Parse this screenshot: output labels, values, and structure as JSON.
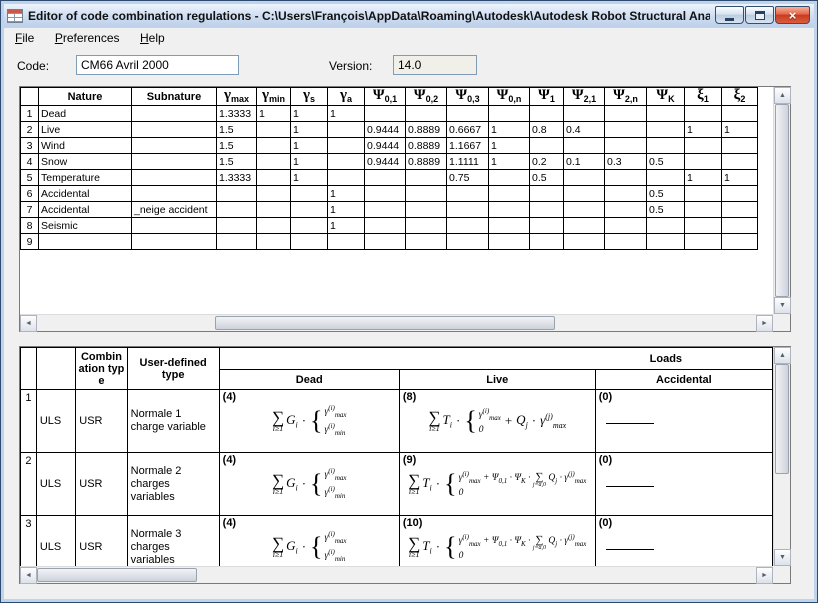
{
  "window": {
    "title": "Editor of code combination regulations - C:\\Users\\François\\AppData\\Roaming\\Autodesk\\Autodesk Robot Structural Analysis ..."
  },
  "colors": {
    "titlebar": "#cdddf2",
    "close_button": "#d9512f",
    "grid_line": "#000000",
    "client_bg": "#f0f0f0"
  },
  "menu": {
    "items": [
      {
        "label": "File"
      },
      {
        "label": "Preferences"
      },
      {
        "label": "Help"
      }
    ]
  },
  "form": {
    "code_label": "Code:",
    "code_value": "CM66 Avril 2000",
    "version_label": "Version:",
    "version_value": "14.0"
  },
  "factors_table": {
    "headers": [
      "",
      "Nature",
      "Subnature",
      "<span class='gk'>γ</span><sub>max</sub>",
      "<span class='gk'>γ</span><sub>min</sub>",
      "<span class='gk'>γ</span><sub>s</sub>",
      "<span class='gk'>γ</span><sub>a</sub>",
      "<span class='gk'>Ψ</span><sub>0,1</sub>",
      "<span class='gk'>Ψ</span><sub>0,2</sub>",
      "<span class='gk'>Ψ</span><sub>0,3</sub>",
      "<span class='gk'>Ψ</span><sub>0,n</sub>",
      "<span class='gk'>Ψ</span><sub>1</sub>",
      "<span class='gk'>Ψ</span><sub>2,1</sub>",
      "<span class='gk'>Ψ</span><sub>2,n</sub>",
      "<span class='gk'>Ψ</span><sub>K</sub>",
      "<span class='gk'>ξ</span><sub>1</sub>",
      "<span class='gk'>ξ</span><sub>2</sub>"
    ],
    "rows": [
      [
        "1",
        "Dead",
        "",
        "1.3333",
        "1",
        "1",
        "1",
        "",
        "",
        "",
        "",
        "",
        "",
        "",
        "",
        "",
        ""
      ],
      [
        "2",
        "Live",
        "",
        "1.5",
        "",
        "1",
        "",
        "0.9444",
        "0.8889",
        "0.6667",
        "1",
        "0.8",
        "0.4",
        "",
        "",
        "1",
        "1"
      ],
      [
        "3",
        "Wind",
        "",
        "1.5",
        "",
        "1",
        "",
        "0.9444",
        "0.8889",
        "1.1667",
        "1",
        "",
        "",
        "",
        "",
        "",
        ""
      ],
      [
        "4",
        "Snow",
        "",
        "1.5",
        "",
        "1",
        "",
        "0.9444",
        "0.8889",
        "1.1111",
        "1",
        "0.2",
        "0.1",
        "0.3",
        "0.5",
        "",
        ""
      ],
      [
        "5",
        "Temperature",
        "",
        "1.3333",
        "",
        "1",
        "",
        "",
        "",
        "0.75",
        "",
        "0.5",
        "",
        "",
        "",
        "1",
        "1"
      ],
      [
        "6",
        "Accidental",
        "",
        "",
        "",
        "",
        "1",
        "",
        "",
        "",
        "",
        "",
        "",
        "",
        "0.5",
        "",
        ""
      ],
      [
        "7",
        "Accidental",
        "_neige accident",
        "",
        "",
        "",
        "1",
        "",
        "",
        "",
        "",
        "",
        "",
        "",
        "0.5",
        "",
        ""
      ],
      [
        "8",
        "Seismic",
        "",
        "",
        "",
        "",
        "1",
        "",
        "",
        "",
        "",
        "",
        "",
        "",
        "",
        "",
        ""
      ],
      [
        "9",
        "",
        "",
        "",
        "",
        "",
        "",
        "",
        "",
        "",
        "",
        "",
        "",
        "",
        "",
        "",
        ""
      ]
    ]
  },
  "combinations_table": {
    "headers": {
      "combination_type": "Combination type",
      "user_defined_type": "User-defined type",
      "loads_group": "Loads",
      "load_columns": [
        "Dead",
        "Live",
        "Accidental"
      ]
    },
    "rows": [
      {
        "num": "1",
        "limit_state": "ULS",
        "combination_type": "USR",
        "name": "Normale 1 charge variable",
        "loads": [
          {
            "tag": "(4)",
            "formula_html": "<span class='bo'><span class='bos'>∑</span><span class='bol'>i≥1</span></span><span class='it'>G<sub>i</sub></span><span class='dot'>·</span><span class='br'>{</span><span class='st'><span>γ<sup>(i)</sup><sub>max</sub></span><span>γ<sup>(i)</sup><sub>min</sub></span></span>"
          },
          {
            "tag": "(8)",
            "formula_html": "<span class='bo'><span class='bos'>∑</span><span class='bol'>i≥1</span></span><span class='it'>T<sub>i</sub></span><span class='dot'>·</span><span class='br'>{</span><span class='st'><span>γ<sup>(i)</sup><sub>max</sub></span><span>0</span></span><span class='dot'>+</span><span class='it'>Q<sub>j</sub></span><span class='dot'>·</span><span class='it'>γ<sup>(j)</sup><sub>max</sub></span>"
          },
          {
            "tag": "(0)",
            "formula_html": "<span class='dashline'></span>"
          }
        ]
      },
      {
        "num": "2",
        "limit_state": "ULS",
        "combination_type": "USR",
        "name": "Normale 2 charges variables",
        "loads": [
          {
            "tag": "(4)",
            "formula_html": "<span class='bo'><span class='bos'>∑</span><span class='bol'>i≥1</span></span><span class='it'>G<sub>i</sub></span><span class='dot'>·</span><span class='br'>{</span><span class='st'><span>γ<sup>(i)</sup><sub>max</sub></span><span>γ<sup>(i)</sup><sub>min</sub></span></span>"
          },
          {
            "tag": "(9)",
            "formula_html": "<span class='bo'><span class='bos'>∑</span><span class='bol'>i≥1</span></span><span class='it'>T<sub>i</sub></span><span class='dot'>·</span><span class='br'>{</span><span class='st'><span>γ<sup>(i)</sup><sub>max</sub> + Ψ<sub>0,1</sub> · Ψ<sub>K</sub> · <span class='bo sm'><span class='bos'>∑</span><span class='bol'>j=a,0</span></span> Q<sub>j</sub> · γ<sup>(j)</sup><sub>max</sub></span><span>0</span></span>"
          },
          {
            "tag": "(0)",
            "formula_html": "<span class='dashline'></span>"
          }
        ]
      },
      {
        "num": "3",
        "limit_state": "ULS",
        "combination_type": "USR",
        "name": "Normale 3 charges variables",
        "loads": [
          {
            "tag": "(4)",
            "formula_html": "<span class='bo'><span class='bos'>∑</span><span class='bol'>i≥1</span></span><span class='it'>G<sub>i</sub></span><span class='dot'>·</span><span class='br'>{</span><span class='st'><span>γ<sup>(i)</sup><sub>max</sub></span><span>γ<sup>(i)</sup><sub>min</sub></span></span>"
          },
          {
            "tag": "(10)",
            "formula_html": "<span class='bo'><span class='bos'>∑</span><span class='bol'>i≥1</span></span><span class='it'>T<sub>i</sub></span><span class='dot'>·</span><span class='br'>{</span><span class='st'><span>γ<sup>(i)</sup><sub>max</sub> + Ψ<sub>0,1</sub> · Ψ<sub>K</sub> · <span class='bo sm'><span class='bos'>∑</span><span class='bol'>j=a,0</span></span> Q<sub>j</sub> · γ<sup>(j)</sup><sub>max</sub></span><span>0</span></span>"
          },
          {
            "tag": "(0)",
            "formula_html": "<span class='dashline'></span>"
          }
        ]
      }
    ]
  }
}
